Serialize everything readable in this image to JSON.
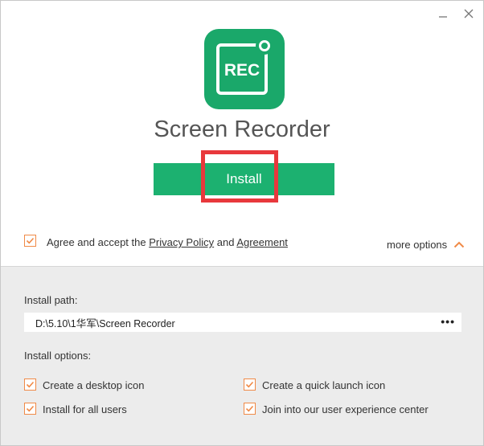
{
  "window": {
    "minimize_icon": "minimize-icon",
    "close_icon": "close-icon"
  },
  "app": {
    "logo_text": "REC",
    "title": "Screen Recorder"
  },
  "install_button": {
    "label": "Install"
  },
  "agreement": {
    "checked": true,
    "prefix": "Agree and accept the ",
    "privacy_link": "Privacy Policy",
    "conjunction": " and ",
    "agreement_link": "Agreement"
  },
  "more_options": {
    "label": "more options",
    "icon": "chevron-up-icon"
  },
  "install_path": {
    "label": "Install path:",
    "value": "D:\\5.10\\1华军\\Screen Recorder",
    "browse_label": "•••"
  },
  "install_options": {
    "label": "Install options:",
    "items": [
      {
        "label": "Create a desktop icon",
        "checked": true
      },
      {
        "label": "Create a quick launch icon",
        "checked": true
      },
      {
        "label": "Install for all users",
        "checked": true
      },
      {
        "label": "Join into our user experience center",
        "checked": true
      }
    ]
  },
  "colors": {
    "brand_green": "#1cb170",
    "checkbox_orange": "#f08a47",
    "highlight_red": "#e8383c"
  }
}
